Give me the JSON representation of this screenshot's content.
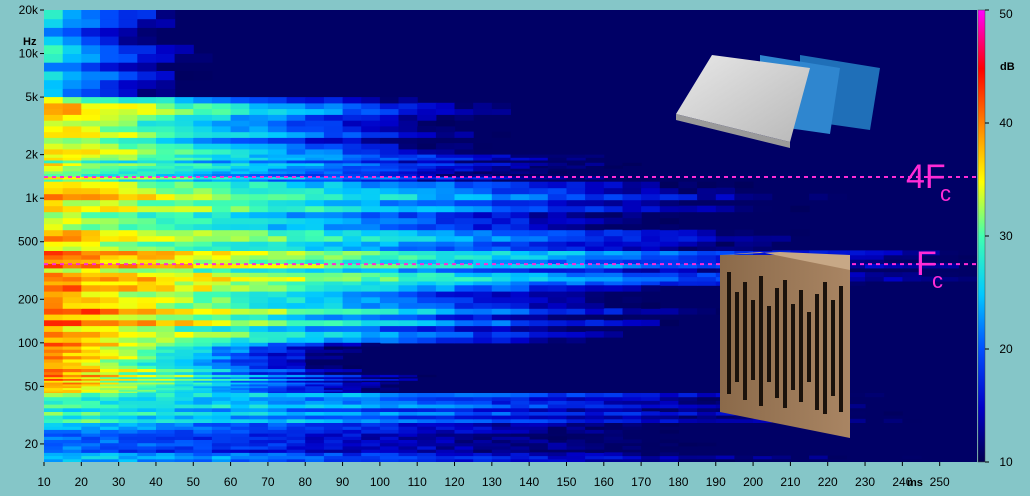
{
  "chart_data": {
    "type": "heatmap",
    "title": "",
    "xlabel": "ms",
    "ylabel": "Hz",
    "colorbar_label": "dB",
    "x_scale": "linear",
    "y_scale": "log",
    "xlim": [
      10,
      260
    ],
    "ylim": [
      15,
      20000
    ],
    "clim": [
      10,
      50
    ],
    "x_ticks": [
      10,
      20,
      30,
      40,
      50,
      60,
      70,
      80,
      90,
      100,
      110,
      120,
      130,
      140,
      150,
      160,
      170,
      180,
      190,
      200,
      210,
      220,
      230,
      240,
      250
    ],
    "x_tick_labels": [
      "10",
      "20",
      "30",
      "40",
      "50",
      "60",
      "70",
      "80",
      "90",
      "100",
      "110",
      "120",
      "130",
      "140",
      "150",
      "160",
      "170",
      "180",
      "190",
      "200",
      "210",
      "220",
      "230",
      "240",
      "250"
    ],
    "y_ticks": [
      20,
      50,
      100,
      200,
      500,
      1000,
      2000,
      5000,
      10000,
      20000
    ],
    "y_tick_labels": [
      "20",
      "50",
      "100",
      "200",
      "500",
      "1k",
      "2k",
      "5k",
      "10k",
      "20k"
    ],
    "colorbar_ticks": [
      10,
      20,
      30,
      40,
      50
    ],
    "colorbar_tick_labels": [
      "10",
      "20",
      "30",
      "40",
      "50"
    ],
    "colormap": [
      "#000050",
      "#0000c8",
      "#0050ff",
      "#00c8ff",
      "#40ffb0",
      "#ffff00",
      "#ff8000",
      "#ff0000",
      "#ff00ff"
    ],
    "bands": [
      {
        "f_low": 5000,
        "f_high": 20000,
        "level_db": 25,
        "decay_ms": 40
      },
      {
        "f_low": 2000,
        "f_high": 5000,
        "level_db": 36,
        "decay_ms": 80
      },
      {
        "f_low": 1300,
        "f_high": 2000,
        "level_db": 34,
        "decay_ms": 110
      },
      {
        "f_low": 500,
        "f_high": 1300,
        "level_db": 36,
        "decay_ms": 130
      },
      {
        "f_low": 250,
        "f_high": 500,
        "level_db": 38,
        "decay_ms": 150
      },
      {
        "f_low": 100,
        "f_high": 250,
        "level_db": 40,
        "decay_ms": 100
      },
      {
        "f_low": 60,
        "f_high": 100,
        "level_db": 40,
        "decay_ms": 50
      },
      {
        "f_low": 45,
        "f_high": 60,
        "level_db": 40,
        "decay_ms": 60
      },
      {
        "f_low": 25,
        "f_high": 45,
        "level_db": 28,
        "decay_ms": 200
      },
      {
        "f_low": 15,
        "f_high": 25,
        "level_db": 24,
        "decay_ms": 250
      }
    ],
    "reference_lines": [
      {
        "label": "4F",
        "subscript": "c",
        "frequency_hz": 1400,
        "color": "#ff2bd6"
      },
      {
        "label": "F",
        "subscript": "c",
        "frequency_hz": 350,
        "color": "#ff2bd6"
      }
    ]
  },
  "images": {
    "foam_panels": "acoustic-foam-panels-photo",
    "diffuser": "wooden-slotted-diffuser-photo"
  }
}
